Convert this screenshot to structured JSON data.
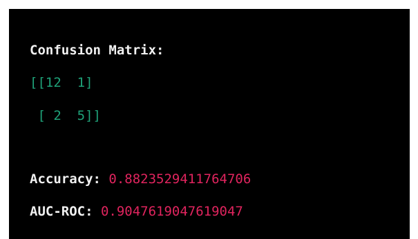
{
  "output": {
    "heading": "Confusion Matrix:",
    "matrix_row_1": "[[12  1]",
    "matrix_row_2": " [ 2  5]]",
    "accuracy_label": "Accuracy: ",
    "accuracy_value": "0.8823529411764706",
    "auc_label": "AUC-ROC: ",
    "auc_value": "0.9047619047619047"
  },
  "colors": {
    "background": "#000000",
    "matrix_text": "#1fa37a",
    "value_text": "#e0245e",
    "label_text": "#f0f0f0"
  }
}
